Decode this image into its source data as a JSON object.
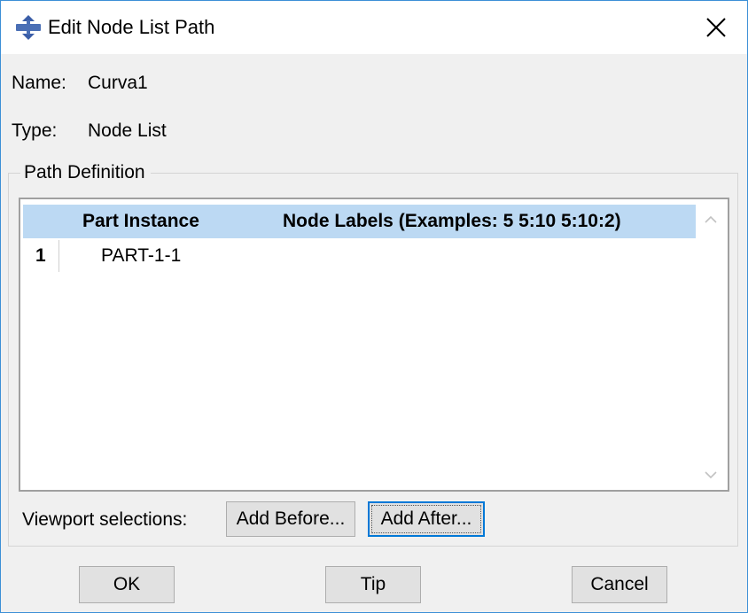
{
  "window": {
    "title": "Edit Node List Path",
    "app_icon": "abaqus-icon",
    "close_icon": "close-icon"
  },
  "fields": {
    "name_label": "Name:",
    "name_value": "Curva1",
    "type_label": "Type:",
    "type_value": "Node List"
  },
  "path_definition": {
    "legend": "Path Definition",
    "columns": [
      "Part Instance",
      "Node Labels (Examples: 5 5:10 5:10:2)"
    ],
    "rows": [
      {
        "index": "1",
        "part_instance": "PART-1-1",
        "node_labels": ""
      }
    ],
    "scroll_up_icon": "chevron-up-icon",
    "scroll_down_icon": "chevron-down-icon"
  },
  "viewport": {
    "label": "Viewport selections:",
    "add_before": "Add Before...",
    "add_after": "Add After..."
  },
  "footer": {
    "ok": "OK",
    "tip": "Tip",
    "cancel": "Cancel"
  },
  "colors": {
    "header_highlight": "#bcd9f3",
    "focus_border": "#0078d7",
    "window_border": "#3c8fd6"
  }
}
